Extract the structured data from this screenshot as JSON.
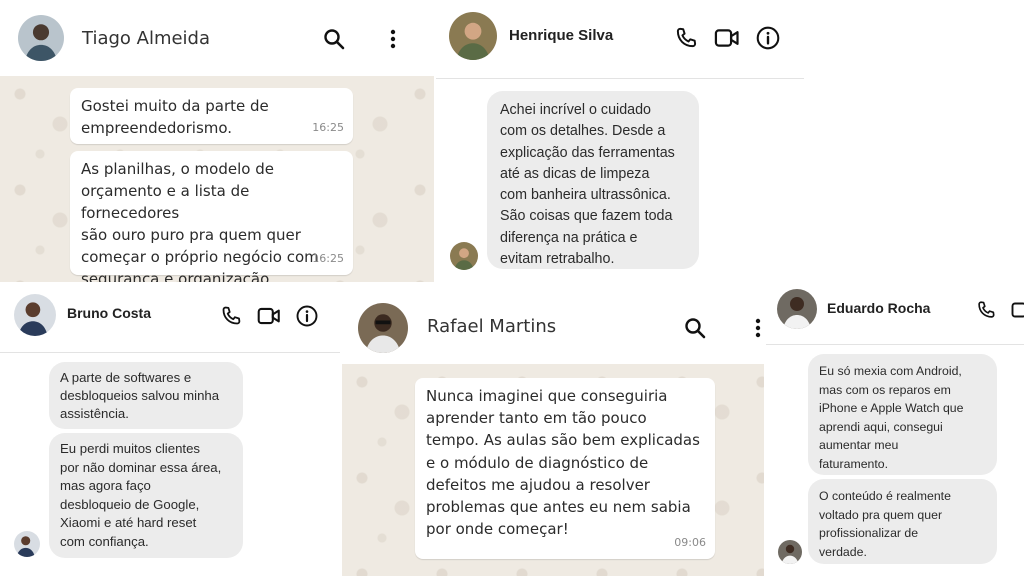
{
  "colors": {
    "whatsapp_bg": "#efeae2",
    "bubble_wa": "#ffffff",
    "bubble_ig": "#ececec",
    "icon": "#111111"
  },
  "chats": {
    "tiago": {
      "contact_name": "Tiago Almeida",
      "header_icons": [
        "search-icon",
        "more-vertical-icon"
      ],
      "messages": [
        {
          "text": "Gostei muito da parte de\nempreendedorismo.",
          "time": "16:25"
        },
        {
          "text": "As planilhas, o modelo de\norçamento e a lista de fornecedores\nsão ouro puro pra quem quer\ncomeçar o próprio negócio com\nsegurança e organização.",
          "time": "16:25"
        }
      ]
    },
    "henrique": {
      "contact_name": "Henrique Silva",
      "header_icons": [
        "phone-icon",
        "video-icon",
        "info-icon"
      ],
      "messages": [
        {
          "text": "Achei incrível o cuidado\ncom os detalhes. Desde a\nexplicação das ferramentas\naté as dicas de limpeza\ncom banheira ultrassônica.\nSão coisas que fazem toda\ndiferença na prática e\nevitam retrabalho."
        }
      ]
    },
    "bruno": {
      "contact_name": "Bruno Costa",
      "header_icons": [
        "phone-icon",
        "video-icon",
        "info-icon"
      ],
      "messages": [
        {
          "text": "A parte de softwares e\ndesbloqueios salvou minha\nassistência."
        },
        {
          "text": "Eu perdi muitos clientes\npor não dominar essa área,\nmas agora faço\ndesbloqueio de Google,\nXiaomi e até hard reset\ncom confiança."
        }
      ]
    },
    "rafael": {
      "contact_name": "Rafael Martins",
      "header_icons": [
        "search-icon",
        "more-vertical-icon"
      ],
      "messages": [
        {
          "text": "Nunca imaginei que conseguiria\naprender tanto em tão pouco\ntempo. As aulas são bem explicadas\ne o módulo de diagnóstico de\ndefeitos me ajudou a resolver\nproblemas que antes eu nem sabia\npor onde começar!",
          "time": "09:06"
        }
      ]
    },
    "eduardo": {
      "contact_name": "Eduardo Rocha",
      "header_icons": [
        "phone-icon",
        "video-icon"
      ],
      "messages": [
        {
          "text": "Eu só mexia com Android,\nmas com os reparos em\niPhone e Apple Watch que\naprendi aqui, consegui\naumentar meu\nfaturamento."
        },
        {
          "text": "O conteúdo é realmente\nvoltado pra quem quer\nprofissionalizar de\nverdade."
        }
      ]
    }
  }
}
